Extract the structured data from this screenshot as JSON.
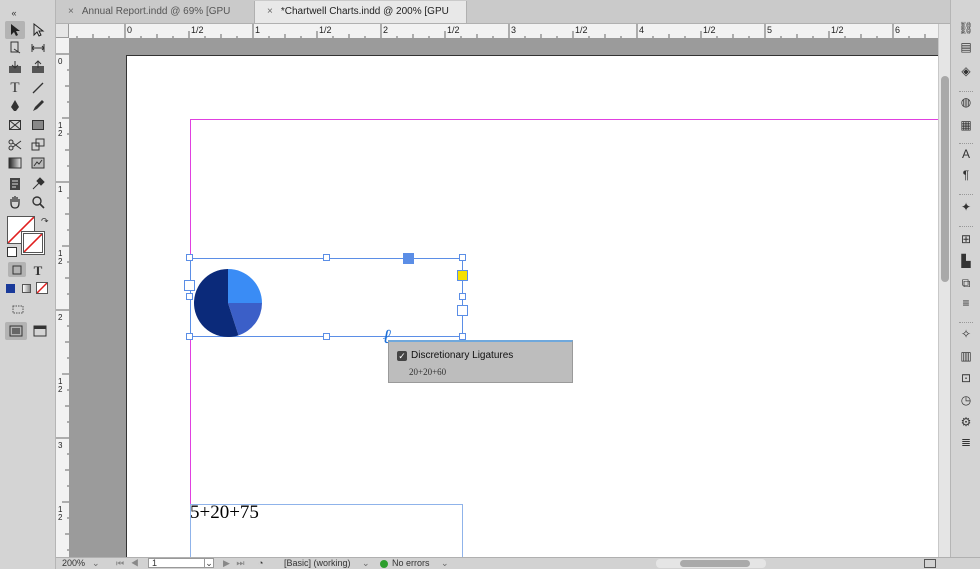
{
  "tabs": [
    {
      "label": "Annual Report.indd @ 69% [GPU Preview]",
      "close": "×"
    },
    {
      "label": "*Chartwell Charts.indd @ 200% [GPU Preview]",
      "close": "×"
    }
  ],
  "panel_collapse": "«",
  "ruler": {
    "horizontal": [
      "0",
      "1/2",
      "1",
      "1/2",
      "2",
      "1/2",
      "3",
      "1/2",
      "4",
      "1/2",
      "5",
      "1/2",
      "6"
    ],
    "vertical": [
      "0",
      "1/2",
      "1",
      "1/2",
      "2",
      "1/2",
      "3",
      "1/2"
    ]
  },
  "tools": {
    "type_label": "T",
    "type_small": "T"
  },
  "canvas": {
    "chart_text": "5+20+75"
  },
  "popup": {
    "checkbox_label": "Discretionary Ligatures",
    "checked": true,
    "preview": "20+20+60"
  },
  "status": {
    "zoom": "200%",
    "page": "1",
    "preflight_profile": "[Basic] (working)",
    "errors": "No errors",
    "errors_color": "#2e9e2e"
  },
  "colors": {
    "chart_dark": "#0b2a7a",
    "chart_mid": "#3b5fc8",
    "chart_light": "#3a8cf5",
    "margin_guide": "#e040e0",
    "frame_blue": "#5b8ee6",
    "fill_swatch": "#1a3a9a"
  },
  "pie": {
    "slices": [
      {
        "value": 25,
        "color": "#3a8cf5"
      },
      {
        "value": 20,
        "color": "#3b5fc8"
      },
      {
        "value": 55,
        "color": "#0b2a7a"
      }
    ]
  }
}
